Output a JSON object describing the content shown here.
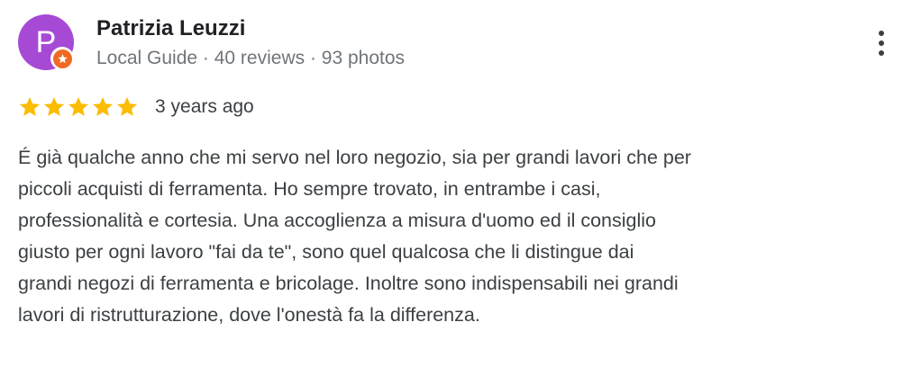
{
  "reviewer": {
    "initial": "P",
    "name": "Patrizia Leuzzi",
    "meta": "Local Guide · 40 reviews · 93 photos",
    "avatar_color": "#a64ad6",
    "badge_color": "#f06a23",
    "badge_icon": "local-guide-star-icon"
  },
  "actions": {
    "more_icon": "more-vert-icon"
  },
  "rating": {
    "stars": 5,
    "max_stars": 5,
    "star_color": "#fbbc04",
    "time": "3 years ago"
  },
  "review": {
    "text": "É già qualche anno che mi servo nel loro negozio, sia per grandi lavori che per\npiccoli acquisti di ferramenta. Ho sempre trovato, in entrambe i casi,\nprofessionalità e cortesia. Una accoglienza a misura d'uomo ed il consiglio\ngiusto per ogni lavoro \"fai da te\", sono quel qualcosa che li distingue dai\ngrandi negozi di ferramenta e bricolage. Inoltre sono indispensabili nei grandi\nlavori di ristrutturazione, dove l'onestà fa la differenza."
  }
}
